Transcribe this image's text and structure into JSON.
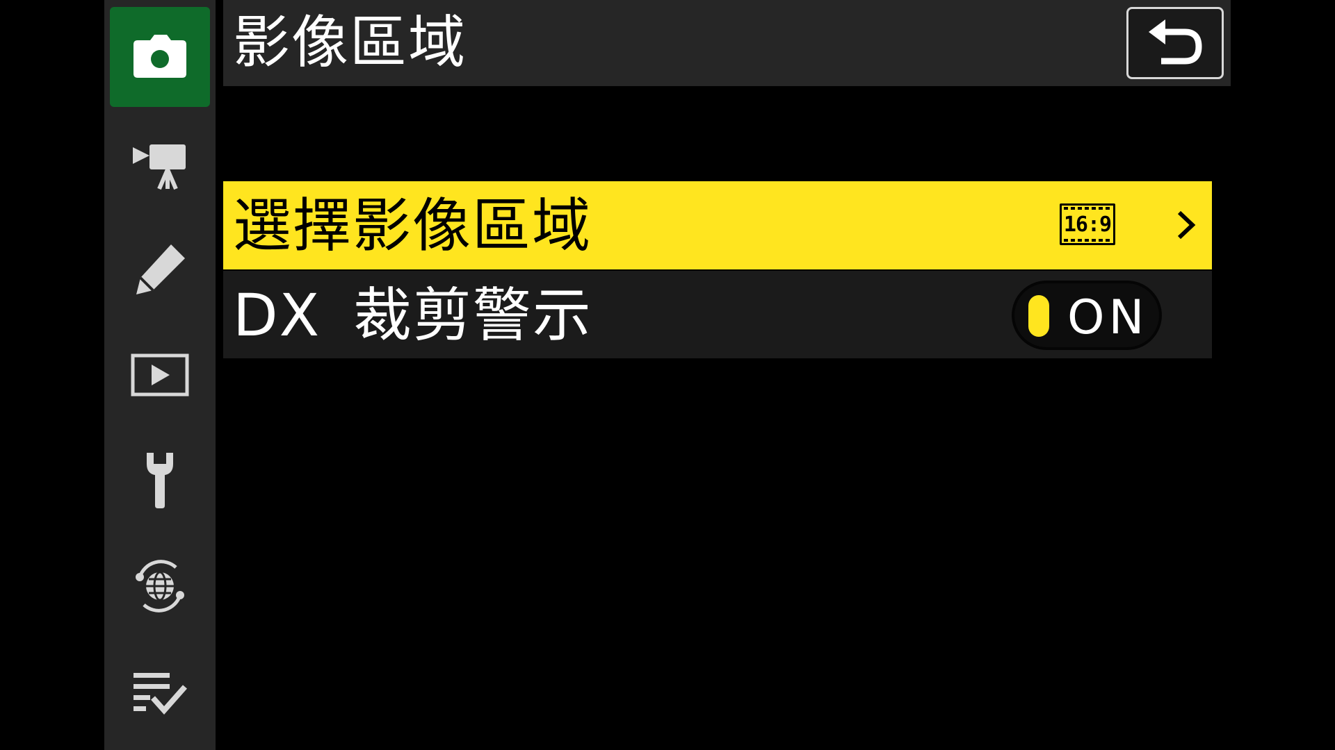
{
  "header": {
    "title": "影像區域",
    "back_icon": "return-arrow-icon"
  },
  "sidebar": {
    "items": [
      {
        "icon": "camera-icon",
        "active": true
      },
      {
        "icon": "movie-camera-icon",
        "active": false
      },
      {
        "icon": "pencil-icon",
        "active": false
      },
      {
        "icon": "playback-icon",
        "active": false
      },
      {
        "icon": "wrench-icon",
        "active": false
      },
      {
        "icon": "network-icon",
        "active": false
      },
      {
        "icon": "my-menu-icon",
        "active": false
      }
    ]
  },
  "menu": {
    "items": [
      {
        "label": "選擇影像區域",
        "value": "16:9",
        "value_icon": "aspect-ratio-16-9-icon",
        "selected": true,
        "arrow_icon": "chevron-right-icon"
      },
      {
        "label": "DX 裁剪警示",
        "toggle": "ON",
        "selected": false
      }
    ]
  },
  "colors": {
    "highlight": "#ffe51f",
    "active_tab": "#0f6b2a",
    "panel": "#262626",
    "background": "#000000"
  }
}
